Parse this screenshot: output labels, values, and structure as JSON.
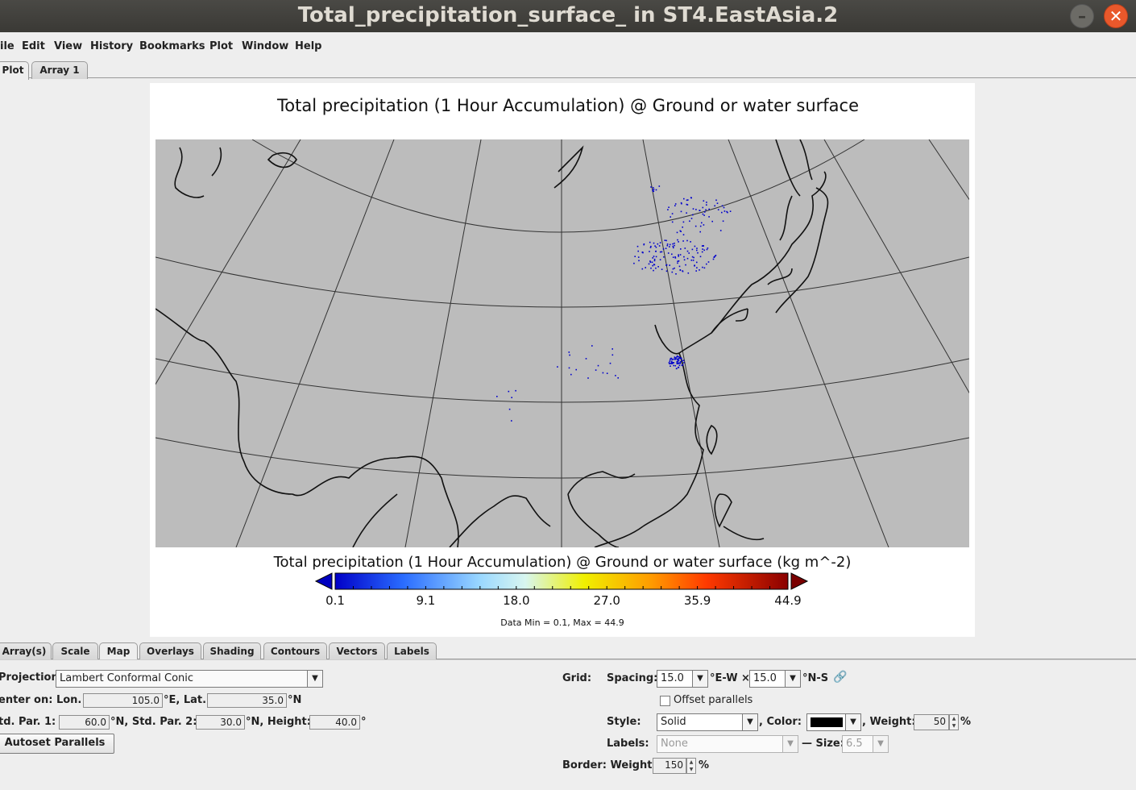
{
  "window": {
    "title": "Total_precipitation_surface_ in ST4.EastAsia.2"
  },
  "menu": [
    "ile",
    "Edit",
    "View",
    "History",
    "Bookmarks",
    "Plot",
    "Window",
    "Help"
  ],
  "top_tabs": [
    "Plot",
    "Array 1"
  ],
  "plot": {
    "title": "Total precipitation (1 Hour Accumulation) @ Ground or water surface",
    "colorbar_title": "Total precipitation (1 Hour Accumulation) @ Ground or water surface (kg m^-2)",
    "colorbar_ticks": [
      "0.1",
      "9.1",
      "18.0",
      "27.0",
      "35.9",
      "44.9"
    ],
    "data_minmax": "Data Min = 0.1, Max = 44.9",
    "colors": {
      "map_bg": "#bcbcbc",
      "points": "#0000cc",
      "coast": "#111111"
    }
  },
  "bottom_tabs": [
    "Array(s)",
    "Scale",
    "Map",
    "Overlays",
    "Shading",
    "Contours",
    "Vectors",
    "Labels"
  ],
  "map_settings": {
    "projection_label": "Projection:",
    "projection_value": "Lambert Conformal Conic",
    "center_label": "enter on: Lon.",
    "center_lon": "105.0",
    "center_lon_unit": "°E, Lat.",
    "center_lat": "35.0",
    "center_lat_unit": "°N",
    "std_par1_label": "td. Par. 1:",
    "std_par1": "60.0",
    "std_par2_label": "°N, Std. Par. 2:",
    "std_par2": "30.0",
    "height_label": "°N, Height:",
    "height": "40.0",
    "height_unit": "°",
    "autoset_button": "Autoset Parallels"
  },
  "grid_settings": {
    "grid_label": "Grid:",
    "spacing_label": "Spacing:",
    "spacing_ew": "15.0",
    "ew_unit": "°E-W ×",
    "spacing_ns": "15.0",
    "ns_unit": "°N-S",
    "offset_label": "Offset parallels",
    "style_label": "Style:",
    "style_value": "Solid",
    "color_label": ", Color:",
    "weight_label": ", Weight:",
    "weight_value": "50",
    "weight_unit": "%",
    "labels_label": "Labels:",
    "labels_value": "None",
    "size_label": "— Size:",
    "size_value": "6.5",
    "border_label": "Border: Weight:",
    "border_weight": "150",
    "border_unit": "%"
  }
}
